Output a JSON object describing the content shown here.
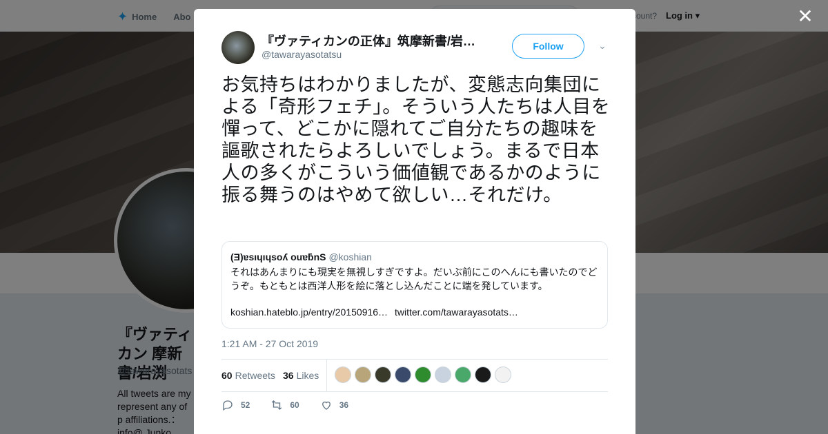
{
  "background": {
    "nav": {
      "home": "Home",
      "about": "Abo"
    },
    "account_text": "ccount?",
    "login": "Log in",
    "profile_name": "『ヴァティ カン 摩新書/岩渕",
    "profile_handle": "@tawarayasotats",
    "bio": "All tweets are my represent any of p affiliations.：info@ Junko IWABUCHI"
  },
  "tweet": {
    "author_name": "『ヴァティカンの正体』筑摩新書/岩…",
    "author_handle": "@tawarayasotatsu",
    "follow_label": "Follow",
    "text": "お気持ちはわかりましたが、変態志向集団による「奇形フェチ」。そういう人たちは人目を憚って、どこかに隠れてご自分たちの趣味を謳歌されたらよろしいでしょう。まるで日本人の多くがこういう価値観であるかのように振る舞うのはやめて欲しい…それだけ。",
    "quote": {
      "name": "(Ǝ)ɐsıɥıɥsoʎ ouɐƃnS",
      "handle": "@koshian",
      "text": "それはあんまりにも現実を無視しすぎですよ。だいぶ前にこのへんにも書いたのでどうぞ。もともとは西洋人形を絵に落とし込んだことに端を発しています。",
      "link1": "koshian.hateblo.jp/entry/20150916…",
      "link2": "twitter.com/tawarayasotats…"
    },
    "timestamp": "1:21 AM - 27 Oct 2019",
    "retweets_count": "60",
    "retweets_label": "Retweets",
    "likes_count": "36",
    "likes_label": "Likes",
    "liker_colors": [
      "#e8c9a8",
      "#b9a57a",
      "#3a3a2a",
      "#3a4a6a",
      "#2e8b2e",
      "#c9d3e0",
      "#4aa86a",
      "#1a1a1a",
      "#f2f2f2"
    ],
    "actions": {
      "reply": "52",
      "retweet": "60",
      "like": "36"
    }
  }
}
